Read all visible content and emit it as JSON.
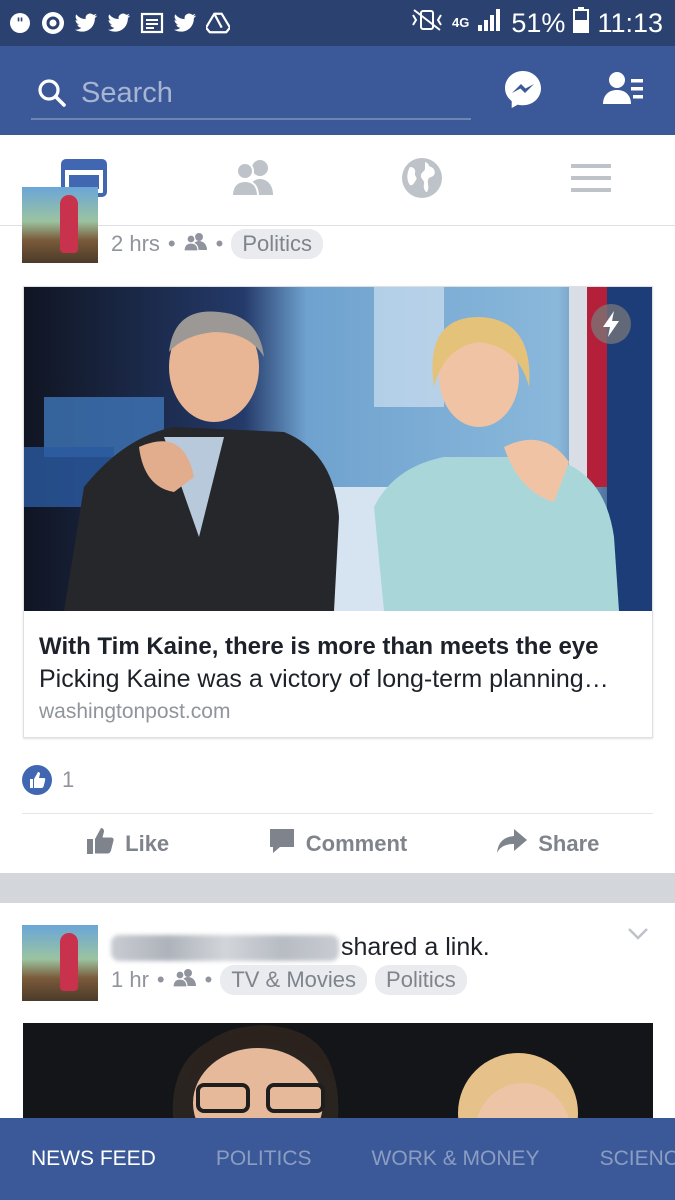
{
  "status_bar": {
    "left_icons": [
      "quote-icon",
      "settings-cog-icon",
      "twitter-bird-icon",
      "twitter-bird-icon",
      "news-icon",
      "twitter-bird-icon",
      "drive-icon"
    ],
    "network_top": "4G",
    "battery": "51%",
    "time": "11:13"
  },
  "header": {
    "search_placeholder": "Search",
    "icons": [
      "messenger-icon",
      "friend-requests-icon"
    ]
  },
  "tabs": [
    {
      "icon": "news-feed-icon",
      "active": true
    },
    {
      "icon": "friends-icon",
      "active": false
    },
    {
      "icon": "globe-icon",
      "active": false
    },
    {
      "icon": "menu-icon",
      "active": false
    }
  ],
  "post1": {
    "time": "2 hrs",
    "topic": "Politics",
    "link": {
      "title": "With Tim Kaine, there is more than meets the eye",
      "description": "Picking Kaine was a victory of long-term planning…",
      "domain": "washingtonpost.com"
    },
    "like_count": "1",
    "actions": {
      "like": "Like",
      "comment": "Comment",
      "share": "Share"
    }
  },
  "post2": {
    "action_text": "shared a link.",
    "time": "1 hr",
    "topics": [
      "TV & Movies",
      "Politics"
    ]
  },
  "bottom_nav": [
    "NEWS FEED",
    "POLITICS",
    "WORK & MONEY",
    "SCIENC"
  ],
  "colors": {
    "status_bar": "#2b4170",
    "brand": "#3b5998",
    "active_tab": "#4267b2",
    "inactive": "#bec2c9"
  }
}
